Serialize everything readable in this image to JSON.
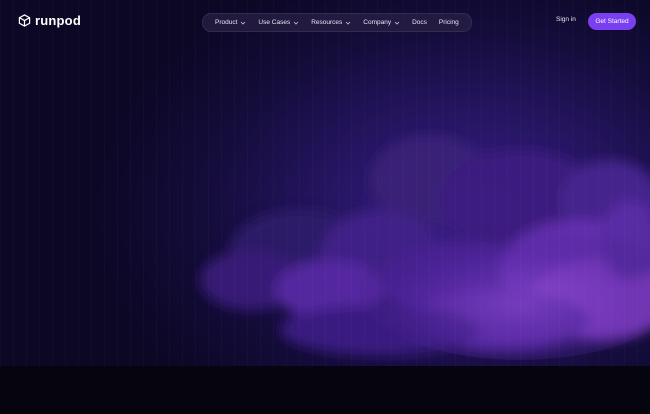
{
  "brand": {
    "name": "runpod",
    "icon": "cube-logo-icon"
  },
  "nav": {
    "items": [
      {
        "label": "Product",
        "has_dropdown": true
      },
      {
        "label": "Use Cases",
        "has_dropdown": true
      },
      {
        "label": "Resources",
        "has_dropdown": true
      },
      {
        "label": "Company",
        "has_dropdown": true
      },
      {
        "label": "Docs",
        "has_dropdown": false
      },
      {
        "label": "Pricing",
        "has_dropdown": false
      }
    ]
  },
  "actions": {
    "signin": "Sign in",
    "get_started": "Get Started"
  },
  "colors": {
    "accent": "#7b3ff2",
    "background": "#07051a",
    "cloud": "#7a3ad0"
  }
}
